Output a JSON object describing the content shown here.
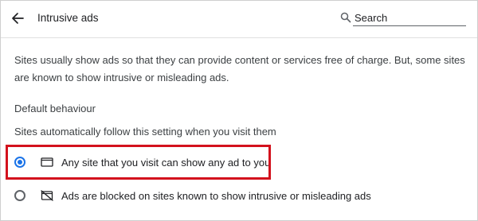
{
  "header": {
    "title": "Intrusive ads",
    "search_placeholder": "Search"
  },
  "description": "Sites usually show ads so that they can provide content or services free of charge. But, some sites are known to show intrusive or misleading ads.",
  "section": {
    "title": "Default behaviour",
    "subtitle": "Sites automatically follow this setting when you visit them"
  },
  "options": [
    {
      "label": "Any site that you visit can show any ad to you",
      "selected": true,
      "icon": "ad-frame-icon"
    },
    {
      "label": "Ads are blocked on sites known to show intrusive or misleading ads",
      "selected": false,
      "icon": "ad-blocked-icon"
    }
  ],
  "colors": {
    "accent": "#1a73e8",
    "highlight_border": "#d3111d"
  }
}
